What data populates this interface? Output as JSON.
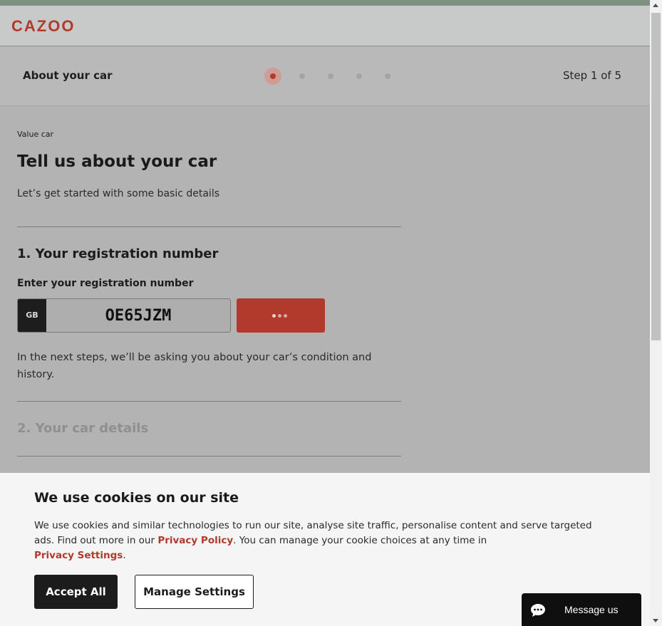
{
  "header": {
    "logo": "CAZOO"
  },
  "stepper": {
    "title": "About your car",
    "step_count": "Step 1 of 5",
    "total_steps": 5,
    "current_step": 1
  },
  "main": {
    "breadcrumb": "Value car",
    "title": "Tell us about your car",
    "subtitle": "Let’s get started with some basic details",
    "section1_title": "1. Your registration number",
    "reg_label": "Enter your registration number",
    "plate_country": "GB",
    "reg_value": "OE65JZM",
    "note": "In the next steps, we’ll be asking you about your car’s condition and history.",
    "section2_title": "2. Your car details"
  },
  "cookie": {
    "title": "We use cookies on our site",
    "text_1": "We use cookies and similar technologies to run our site, analyse site traffic, personalise content and serve targeted ads. Find out more in our ",
    "privacy_policy_link": "Privacy Policy",
    "text_2": ". You can manage your cookie choices at any time in ",
    "privacy_settings_link": "Privacy Settings",
    "text_3": ".",
    "accept_label": "Accept All",
    "manage_label": "Manage Settings"
  },
  "chat": {
    "label": "Message us",
    "icon": "chat-bubble-icon"
  },
  "colors": {
    "brand": "#b13a2d",
    "dark": "#1c1c1c"
  }
}
